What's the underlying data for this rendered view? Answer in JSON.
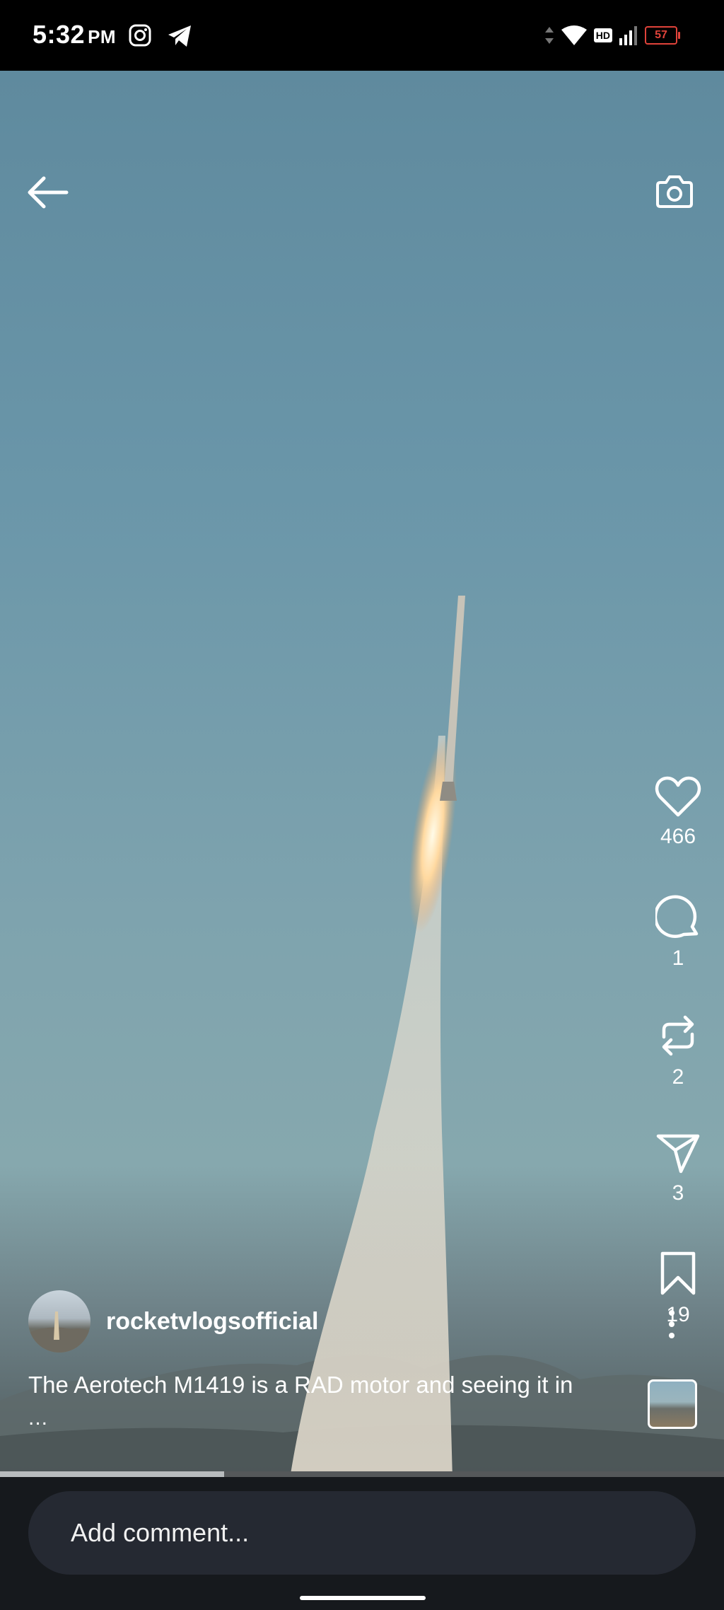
{
  "status_bar": {
    "time": "5:32",
    "ampm": "PM",
    "network_badge": "HD",
    "battery_level": "57",
    "battery_color": "#e0433a"
  },
  "top_bar": {
    "back_icon": "arrow-left-icon",
    "camera_icon": "camera-icon"
  },
  "actions": [
    {
      "name": "like",
      "icon": "heart-icon",
      "count": "466"
    },
    {
      "name": "comment",
      "icon": "comment-bubble-icon",
      "count": "1"
    },
    {
      "name": "repost",
      "icon": "repost-icon",
      "count": "2"
    },
    {
      "name": "share",
      "icon": "send-icon",
      "count": "3"
    },
    {
      "name": "save",
      "icon": "bookmark-icon",
      "count": "19"
    }
  ],
  "post": {
    "username": "rocketvlogsofficial",
    "caption": "The Aerotech M1419 is a RAD motor and seeing it in",
    "caption_more": "...",
    "progress": 0.31
  },
  "comment_bar": {
    "placeholder": "Add comment..."
  }
}
